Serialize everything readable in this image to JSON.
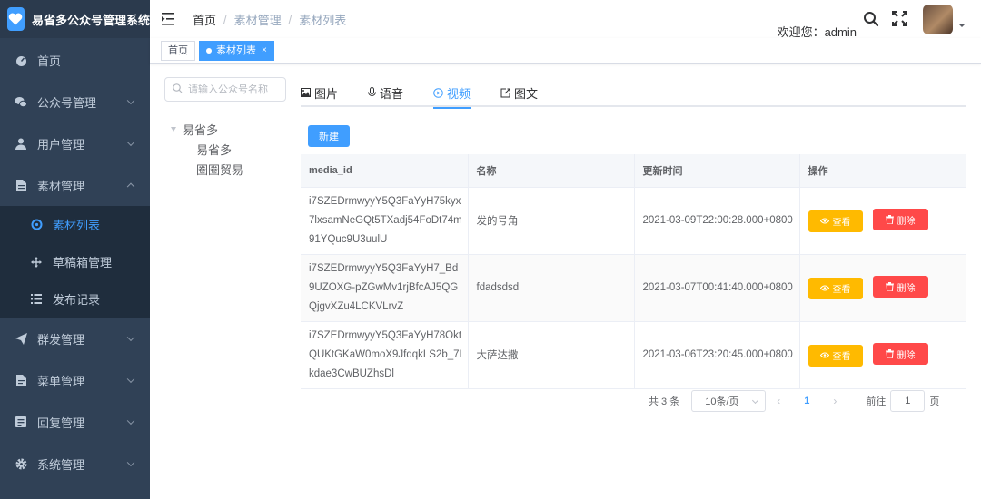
{
  "app": {
    "title": "易省多公众号管理系统"
  },
  "sidebar": {
    "items": [
      {
        "label": "首页",
        "icon": "dashboard-icon"
      },
      {
        "label": "公众号管理",
        "icon": "wechat-icon"
      },
      {
        "label": "用户管理",
        "icon": "user-icon"
      },
      {
        "label": "素材管理",
        "icon": "document-icon",
        "expanded": true,
        "children": [
          {
            "label": "素材列表",
            "icon": "target-icon",
            "active": true
          },
          {
            "label": "草稿箱管理",
            "icon": "move-icon"
          },
          {
            "label": "发布记录",
            "icon": "list-icon"
          }
        ]
      },
      {
        "label": "群发管理",
        "icon": "send-icon"
      },
      {
        "label": "菜单管理",
        "icon": "menu-doc-icon"
      },
      {
        "label": "回复管理",
        "icon": "reply-icon"
      },
      {
        "label": "系统管理",
        "icon": "gear-icon"
      }
    ]
  },
  "header": {
    "breadcrumb": [
      "首页",
      "素材管理",
      "素材列表"
    ],
    "welcome": "欢迎您：admin"
  },
  "tags": [
    {
      "label": "首页",
      "active": false
    },
    {
      "label": "素材列表",
      "active": true
    }
  ],
  "tree": {
    "search_placeholder": "请输入公众号名称",
    "root": "易省多",
    "children": [
      "易省多",
      "圈圈贸易"
    ]
  },
  "tabs": [
    {
      "label": "图片",
      "icon": "image-icon"
    },
    {
      "label": "语音",
      "icon": "mic-icon"
    },
    {
      "label": "视频",
      "icon": "video-icon",
      "active": true
    },
    {
      "label": "图文",
      "icon": "article-icon"
    }
  ],
  "toolbar": {
    "new_label": "新建"
  },
  "table": {
    "columns": [
      "media_id",
      "名称",
      "更新时间",
      "操作"
    ],
    "rows": [
      {
        "media_id": "i7SZEDrmwyyY5Q3FaYyH75kyx7lxsamNeGQt5TXadj54FoDt74m91YQuc9U3uulU",
        "name": "发的号角",
        "updated": "2021-03-09T22:00:28.000+0800"
      },
      {
        "media_id": "i7SZEDrmwyyY5Q3FaYyH7_Bd9UZOXG-pZGwMv1rjBfcAJ5QGQjgvXZu4LCKVLrvZ",
        "name": "fdadsdsd",
        "updated": "2021-03-07T00:41:40.000+0800"
      },
      {
        "media_id": "i7SZEDrmwyyY5Q3FaYyH78OktQUKtGKaW0moX9JfdqkLS2b_7Ikdae3CwBUZhsDl",
        "name": "大萨达撒",
        "updated": "2021-03-06T23:20:45.000+0800"
      }
    ],
    "view_label": "查看",
    "delete_label": "删除"
  },
  "pagination": {
    "total_text": "共 3 条",
    "page_size": "10条/页",
    "current": "1",
    "goto_prefix": "前往",
    "goto_value": "1",
    "goto_suffix": "页"
  },
  "colors": {
    "primary": "#409eff",
    "sidebar": "#304156",
    "warning": "#ffba00",
    "danger": "#ff4949"
  }
}
